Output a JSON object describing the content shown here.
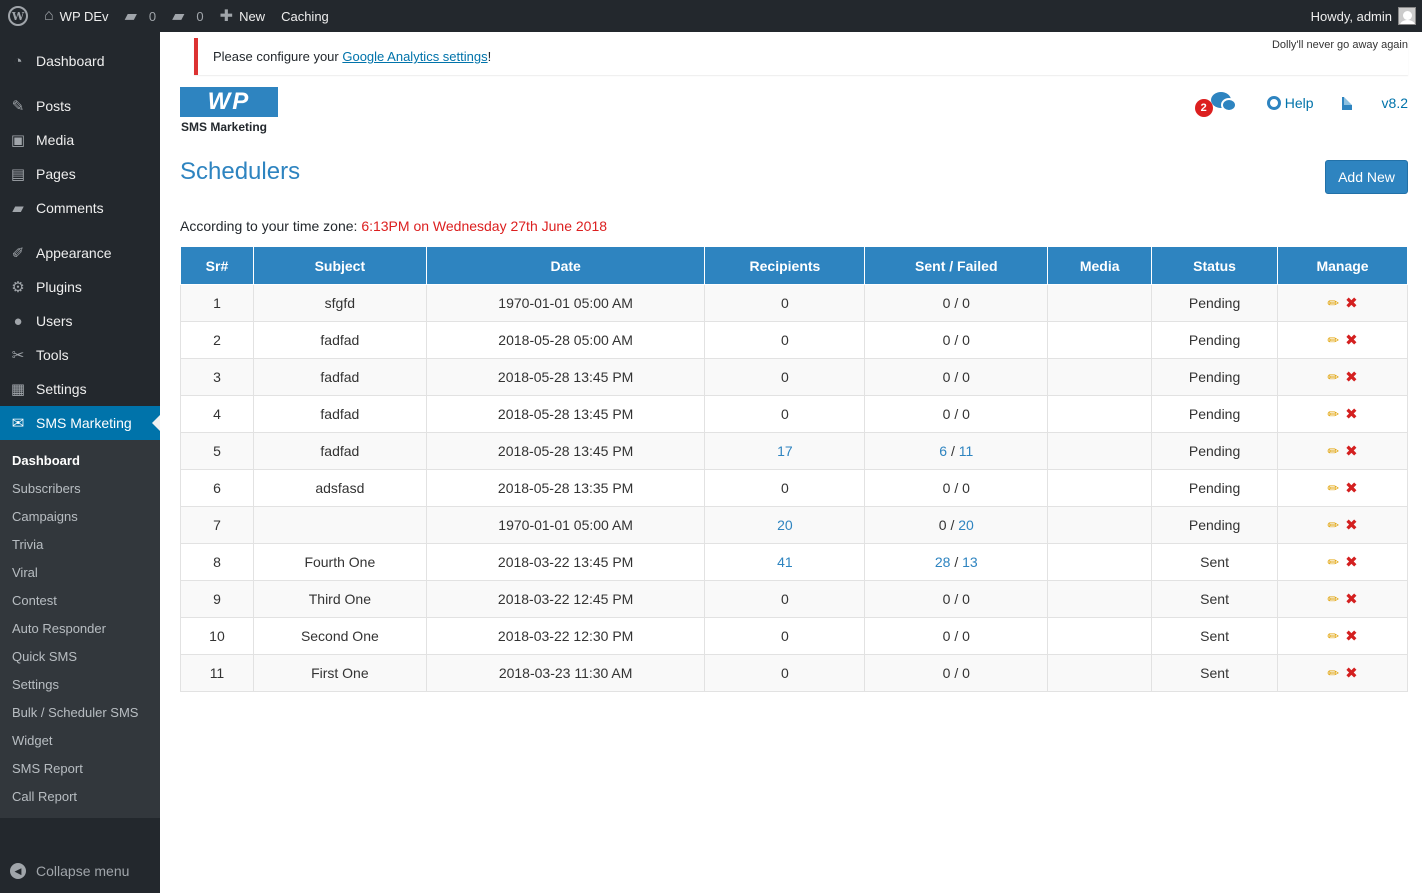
{
  "adminbar": {
    "site_name": "WP DEv",
    "comments_count": "0",
    "messages_count": "0",
    "new_label": "New",
    "caching_label": "Caching",
    "howdy": "Howdy, admin"
  },
  "sidebar": {
    "items": [
      {
        "label": "Dashboard",
        "icon": "dashboard-icon",
        "glyph": "◔"
      },
      {
        "label": "Posts",
        "icon": "pin-icon",
        "glyph": "✎"
      },
      {
        "label": "Media",
        "icon": "media-icon",
        "glyph": "▣"
      },
      {
        "label": "Pages",
        "icon": "pages-icon",
        "glyph": "▤"
      },
      {
        "label": "Comments",
        "icon": "comments-icon",
        "glyph": "▰"
      },
      {
        "label": "Appearance",
        "icon": "brush-icon",
        "glyph": "✐"
      },
      {
        "label": "Plugins",
        "icon": "plugin-icon",
        "glyph": "⚙"
      },
      {
        "label": "Users",
        "icon": "user-icon",
        "glyph": "●"
      },
      {
        "label": "Tools",
        "icon": "wrench-icon",
        "glyph": "✂"
      },
      {
        "label": "Settings",
        "icon": "settings-icon",
        "glyph": "▦"
      },
      {
        "label": "SMS Marketing",
        "icon": "sms-icon",
        "glyph": "✉"
      }
    ],
    "submenu": [
      "Dashboard",
      "Subscribers",
      "Campaigns",
      "Trivia",
      "Viral",
      "Contest",
      "Auto Responder",
      "Quick SMS",
      "Settings",
      "Bulk / Scheduler SMS",
      "Widget",
      "SMS Report",
      "Call Report"
    ],
    "collapse_label": "Collapse menu"
  },
  "notice": {
    "prefix": "Please configure your ",
    "link": "Google Analytics settings",
    "suffix": "!"
  },
  "dolly": "Dolly'll never go away again",
  "logo": {
    "mark": "WP",
    "sub": "SMS Marketing"
  },
  "header": {
    "chat_badge": "2",
    "help_label": "Help",
    "version": "v8.2"
  },
  "page": {
    "title": "Schedulers",
    "add_new_label": "Add New",
    "tz_prefix": "According to your time zone: ",
    "tz_value": "6:13PM on Wednesday 27th June 2018"
  },
  "table": {
    "headers": [
      "Sr#",
      "Subject",
      "Date",
      "Recipients",
      "Sent / Failed",
      "Media",
      "Status",
      "Manage"
    ],
    "rows": [
      {
        "sr": "1",
        "subject": "sfgfd",
        "date": "1970-01-01 05:00 AM",
        "recipients": "0",
        "sent": "0",
        "failed": "0",
        "media": "",
        "status": "Pending",
        "r_link": false,
        "s_link": false,
        "f_link": false
      },
      {
        "sr": "2",
        "subject": "fadfad",
        "date": "2018-05-28 05:00 AM",
        "recipients": "0",
        "sent": "0",
        "failed": "0",
        "media": "",
        "status": "Pending",
        "r_link": false,
        "s_link": false,
        "f_link": false
      },
      {
        "sr": "3",
        "subject": "fadfad",
        "date": "2018-05-28 13:45 PM",
        "recipients": "0",
        "sent": "0",
        "failed": "0",
        "media": "",
        "status": "Pending",
        "r_link": false,
        "s_link": false,
        "f_link": false
      },
      {
        "sr": "4",
        "subject": "fadfad",
        "date": "2018-05-28 13:45 PM",
        "recipients": "0",
        "sent": "0",
        "failed": "0",
        "media": "",
        "status": "Pending",
        "r_link": false,
        "s_link": false,
        "f_link": false
      },
      {
        "sr": "5",
        "subject": "fadfad",
        "date": "2018-05-28 13:45 PM",
        "recipients": "17",
        "sent": "6",
        "failed": "11",
        "media": "",
        "status": "Pending",
        "r_link": true,
        "s_link": true,
        "f_link": true
      },
      {
        "sr": "6",
        "subject": "adsfasd",
        "date": "2018-05-28 13:35 PM",
        "recipients": "0",
        "sent": "0",
        "failed": "0",
        "media": "",
        "status": "Pending",
        "r_link": false,
        "s_link": false,
        "f_link": false
      },
      {
        "sr": "7",
        "subject": "",
        "date": "1970-01-01 05:00 AM",
        "recipients": "20",
        "sent": "0",
        "failed": "20",
        "media": "",
        "status": "Pending",
        "r_link": true,
        "s_link": false,
        "f_link": true
      },
      {
        "sr": "8",
        "subject": "Fourth One",
        "date": "2018-03-22 13:45 PM",
        "recipients": "41",
        "sent": "28",
        "failed": "13",
        "media": "",
        "status": "Sent",
        "r_link": true,
        "s_link": true,
        "f_link": true
      },
      {
        "sr": "9",
        "subject": "Third One",
        "date": "2018-03-22 12:45 PM",
        "recipients": "0",
        "sent": "0",
        "failed": "0",
        "media": "",
        "status": "Sent",
        "r_link": false,
        "s_link": false,
        "f_link": false
      },
      {
        "sr": "10",
        "subject": "Second One",
        "date": "2018-03-22 12:30 PM",
        "recipients": "0",
        "sent": "0",
        "failed": "0",
        "media": "",
        "status": "Sent",
        "r_link": false,
        "s_link": false,
        "f_link": false
      },
      {
        "sr": "11",
        "subject": "First One",
        "date": "2018-03-23 11:30 AM",
        "recipients": "0",
        "sent": "0",
        "failed": "0",
        "media": "",
        "status": "Sent",
        "r_link": false,
        "s_link": false,
        "f_link": false
      }
    ]
  },
  "colors": {
    "accent": "#2e84c0",
    "adminbar": "#23282d",
    "danger": "#dc1f1f"
  }
}
